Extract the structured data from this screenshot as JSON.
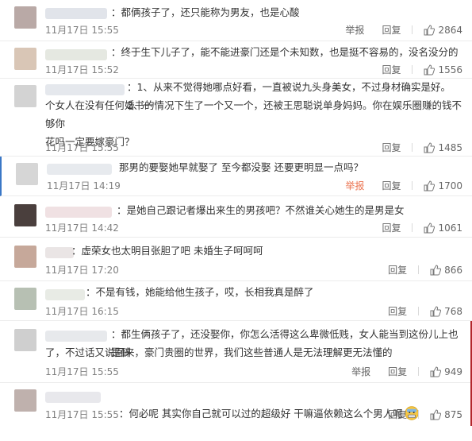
{
  "colors": {
    "report_red": "#eb7350",
    "highlight_blue": "#3a77c6",
    "meta_gray": "#808080"
  },
  "actions": {
    "report": "举报",
    "reply": "回复"
  },
  "icons": {
    "like": "thumbs-up-icon",
    "emoji": "grimace-emoji-icon"
  },
  "comments": [
    {
      "text": "：都俩孩子了，还只能称为男友，也是心酸",
      "time": "11月17日 15:55",
      "likes": "2864",
      "show_report": true
    },
    {
      "text": "：终于生下儿子了，能不能进豪门还是个未知数，也是挺不容易的，没名没分的",
      "time": "11月17日 15:52",
      "likes": "1556",
      "show_report": false
    },
    {
      "text_line1": "：1、从来不觉得她哪点好看，一直被说九头身美女，不过身材确实是好。2、一",
      "text_rest": "个女人在没有任何婚书的情况下生了一个又一个，还被王思聪说单身妈妈。你在娱乐圈赚的钱不够你\n花吗一定要嫁豪门？",
      "time": "11月17日 15:55",
      "likes": "1485",
      "show_report": false
    },
    {
      "text": "那男的要娶她早就娶了 至今都没娶 还要更明显一点吗？",
      "time": "11月17日 14:19",
      "likes": "1700",
      "show_report": true,
      "report_red": true
    },
    {
      "text": "：是她自己跟记者爆出来生的男孩吧？不然谁关心她生的是男是女",
      "time": "11月17日 14:42",
      "likes": "1061",
      "show_report": false
    },
    {
      "text": "：虚荣女也太明目张胆了吧 未婚生子呵呵呵",
      "time": "11月17日 17:20",
      "likes": "866",
      "show_report": false
    },
    {
      "text": "：不是有钱，她能给他生孩子，哎，长相我真是醉了",
      "time": "11月17日 16:15",
      "likes": "768",
      "show_report": false
    },
    {
      "text_line1": "：都生俩孩子了，还没娶你，你怎么活得这么卑微低贱，女人能当到这份儿上也是醉",
      "text_rest": "了，不过话又说回来，豪门贵圈的世界，我们这些普通人是无法理解更无法懂的",
      "time": "11月17日 15:55",
      "likes": "949",
      "show_report": true
    },
    {
      "text": "：何必呢 其实你自己就可以过的超级好 干嘛逼依赖这么个男人呢",
      "time": "11月17日 15:55",
      "likes": "875",
      "show_report": false
    }
  ]
}
